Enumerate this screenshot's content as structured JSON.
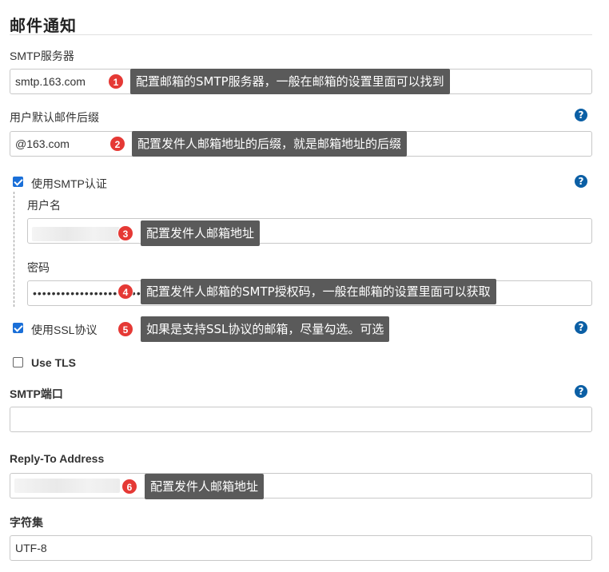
{
  "section": {
    "title": "邮件通知"
  },
  "smtp_server": {
    "label": "SMTP服务器",
    "value": "smtp.163.com"
  },
  "default_suffix": {
    "label": "用户默认邮件后缀",
    "value": "@163.com"
  },
  "use_smtp_auth": {
    "label": "使用SMTP认证",
    "checked": true
  },
  "username": {
    "label": "用户名",
    "value": ""
  },
  "password": {
    "label": "密码",
    "value": "••••••••••••••••••••••••••••••••••••••••••"
  },
  "use_ssl": {
    "label": "使用SSL协议",
    "checked": true
  },
  "use_tls": {
    "label": "Use TLS",
    "checked": false
  },
  "smtp_port": {
    "label": "SMTP端口",
    "value": ""
  },
  "reply_to": {
    "label": "Reply-To Address",
    "value": ""
  },
  "charset": {
    "label": "字符集",
    "value": "UTF-8"
  },
  "help": {
    "glyph": "?"
  },
  "annotations": [
    {
      "num": "1",
      "text": "配置邮箱的SMTP服务器，一般在邮箱的设置里面可以找到"
    },
    {
      "num": "2",
      "text": "配置发件人邮箱地址的后缀，就是邮箱地址的后缀"
    },
    {
      "num": "3",
      "text": "配置发件人邮箱地址"
    },
    {
      "num": "4",
      "text": "配置发件人邮箱的SMTP授权码，一般在邮箱的设置里面可以获取"
    },
    {
      "num": "5",
      "text": "如果是支持SSL协议的邮箱，尽量勾选。可选"
    },
    {
      "num": "6",
      "text": "配置发件人邮箱地址"
    }
  ],
  "colors": {
    "accent": "#1a6fd8",
    "help": "#0b5fa5",
    "badge": "#e53935",
    "tooltip": "#5a5a5a"
  }
}
